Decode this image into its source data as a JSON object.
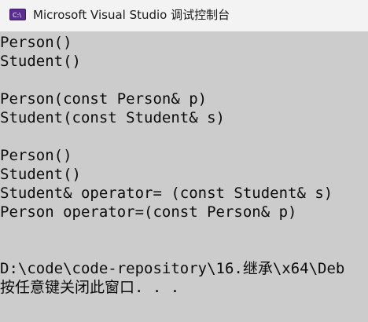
{
  "window": {
    "title": "Microsoft Visual Studio 调试控制台",
    "icon": "console-app-icon"
  },
  "console": {
    "lines": [
      "Person()",
      "Student()",
      "",
      "Person(const Person& p)",
      "Student(const Student& s)",
      "",
      "Person()",
      "Student()",
      "Student& operator= (const Student& s)",
      "Person operator=(const Person& p)",
      "",
      "",
      "D:\\code\\code-repository\\16.继承\\x64\\Deb",
      "按任意键关闭此窗口. . ."
    ]
  },
  "colors": {
    "titlebar_bg": "#f3f3f3",
    "console_bg": "#cccccc",
    "console_text": "#0c0c0c",
    "icon_bg": "#5c2d91"
  }
}
